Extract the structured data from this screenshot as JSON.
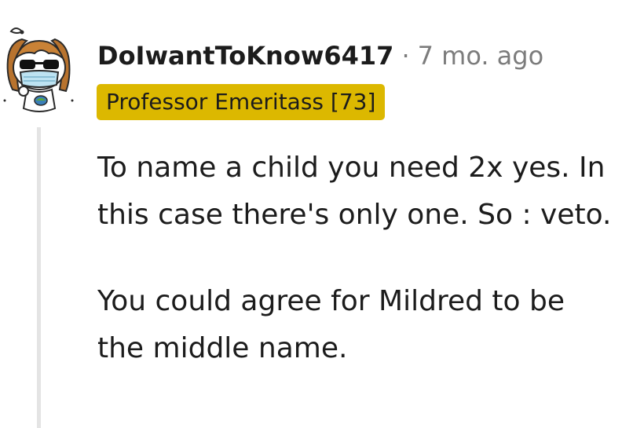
{
  "comment": {
    "username": "DoIwantToKnow6417",
    "separator": "·",
    "timestamp": "7 mo. ago",
    "flair": "Professor Emeritass [73]",
    "flair_color": "#dcb800",
    "avatar_icon": "snoo-avatar-sunglasses-mask-icon",
    "paragraphs": [
      "To name a child you need 2x yes. In this case there's only one. So : veto.",
      "You could agree for Mildred to be the middle name."
    ]
  }
}
